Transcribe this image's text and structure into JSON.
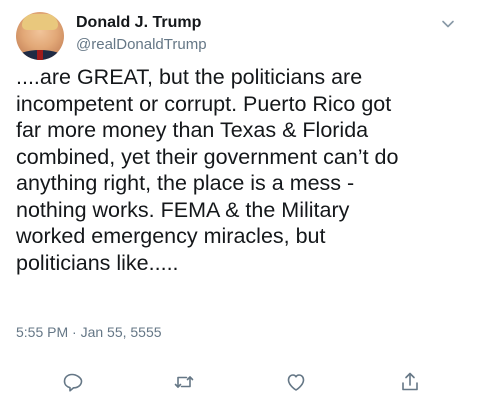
{
  "tweet": {
    "author_name": "Donald J. Trump",
    "author_handle": "@realDonaldTrump",
    "text": "....are GREAT, but the politicians are\nincompetent or corrupt. Puerto Rico got\nfar more money than Texas & Florida\ncombined, yet their government can’t do\nanything right, the place is a mess -\nnothing works. FEMA & the Military\nworked emergency miracles, but\npoliticians like.....",
    "timestamp": "5:55 PM · Jan 55, 5555"
  },
  "icons": {
    "more": "chevron-down-icon",
    "reply": "reply-icon",
    "retweet": "retweet-icon",
    "like": "heart-icon",
    "share": "share-icon"
  },
  "colors": {
    "text": "#14171a",
    "secondary": "#657786",
    "icon": "#657786"
  }
}
